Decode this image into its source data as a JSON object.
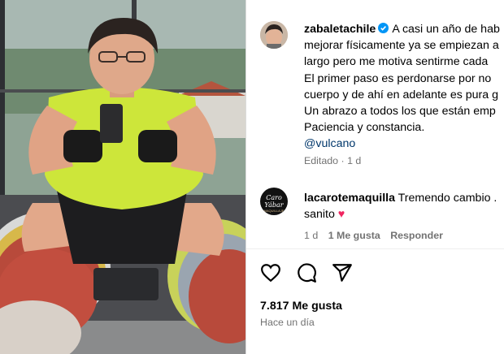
{
  "post": {
    "username": "zabaletachile",
    "caption_lines": [
      "A casi un año de hab",
      "mejorar físicamente ya se empiezan a",
      "largo pero me motiva sentirme cada",
      "El primer paso es perdonarse por no",
      "cuerpo y de ahí en adelante es pura g",
      "Un abrazo a todos los que están emp",
      "Paciencia y constancia."
    ],
    "mention": "@vulcano",
    "edited_label": "Editado",
    "edited_sep": "·",
    "edited_time": "1 d"
  },
  "comment": {
    "avatar_text_1": "Caro Yábar",
    "avatar_text_2": "MAQUILLAJE",
    "username": "lacarotemaquilla",
    "text_line1": "Tremendo cambio .",
    "text_line2": "sanito",
    "emoji": "♥",
    "time": "1 d",
    "likes": "1 Me gusta",
    "reply": "Responder"
  },
  "footer": {
    "likes": "7.817 Me gusta",
    "time": "Hace un día"
  },
  "icons": [
    "heart-icon",
    "comment-icon",
    "share-icon",
    "verified-icon"
  ],
  "colors": {
    "verified": "#0095f6",
    "mention": "#00376b",
    "meta": "#737373",
    "heart_emoji": "#f0245f"
  }
}
